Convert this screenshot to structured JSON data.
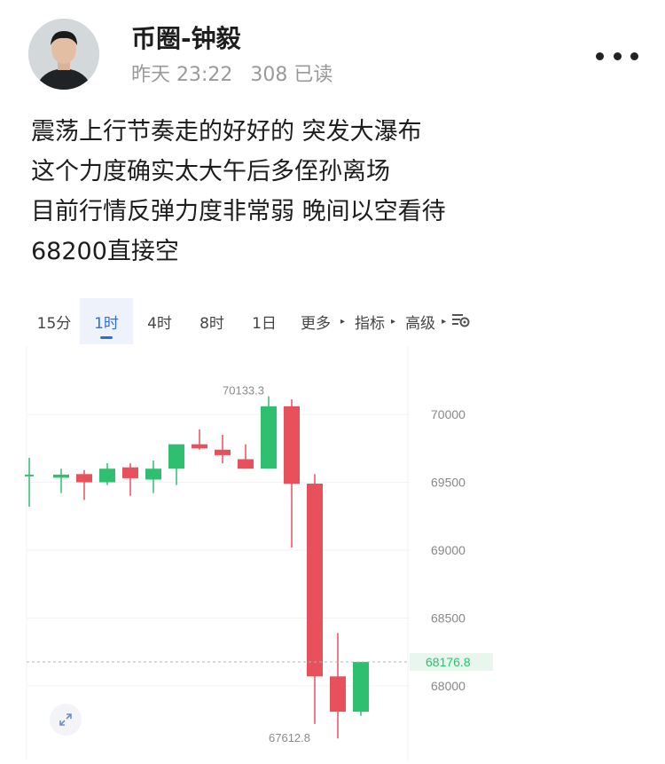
{
  "post": {
    "author": "币圈-钟毅",
    "time": "昨天 23:22",
    "reads": "308 已读",
    "lines": [
      "震荡上行节奏走的好好的 突发大瀑布",
      "这个力度确实太大午后多侄孙离场",
      "目前行情反弹力度非常弱 晚间以空看待",
      "68200直接空"
    ]
  },
  "tabs": [
    {
      "label": "15分",
      "active": false
    },
    {
      "label": "1时",
      "active": true
    },
    {
      "label": "4时",
      "active": false
    },
    {
      "label": "8时",
      "active": false
    },
    {
      "label": "1日",
      "active": false
    },
    {
      "label": "更多",
      "active": false
    },
    {
      "label": "指标",
      "active": false
    },
    {
      "label": "高级",
      "active": false
    }
  ],
  "icons": [
    "avatar",
    "more-dots-icon",
    "chart-settings-icon",
    "expand-icon"
  ],
  "colors": {
    "up": "#2fbf71",
    "down": "#e8505b",
    "accent": "#2f6fd4"
  },
  "chart_data": {
    "type": "candlestick",
    "ylim": [
      67550,
      70300
    ],
    "yticks": [
      70000,
      69500,
      69000,
      68500,
      68000
    ],
    "current_price": "68176.8",
    "high_label": "70133.3",
    "low_label": "67612.8",
    "candles": [
      {
        "o": 69550,
        "h": 69680,
        "l": 69320,
        "c": 69550
      },
      {
        "o": 69540,
        "h": 69600,
        "l": 69420,
        "c": 69550
      },
      {
        "o": 69560,
        "h": 69590,
        "l": 69370,
        "c": 69500
      },
      {
        "o": 69500,
        "h": 69640,
        "l": 69480,
        "c": 69600
      },
      {
        "o": 69610,
        "h": 69640,
        "l": 69400,
        "c": 69530
      },
      {
        "o": 69520,
        "h": 69660,
        "l": 69420,
        "c": 69600
      },
      {
        "o": 69600,
        "h": 69760,
        "l": 69480,
        "c": 69780
      },
      {
        "o": 69780,
        "h": 69890,
        "l": 69740,
        "c": 69750
      },
      {
        "o": 69740,
        "h": 69850,
        "l": 69640,
        "c": 69700
      },
      {
        "o": 69670,
        "h": 69780,
        "l": 69600,
        "c": 69600
      },
      {
        "o": 69600,
        "h": 70133.3,
        "l": 69600,
        "c": 70060
      },
      {
        "o": 70060,
        "h": 70110,
        "l": 69020,
        "c": 69490
      },
      {
        "o": 69490,
        "h": 69560,
        "l": 67720,
        "c": 68070
      },
      {
        "o": 68070,
        "h": 68390,
        "l": 67612.8,
        "c": 67810
      },
      {
        "o": 67810,
        "h": 68170,
        "l": 67780,
        "c": 68176.8
      }
    ]
  }
}
